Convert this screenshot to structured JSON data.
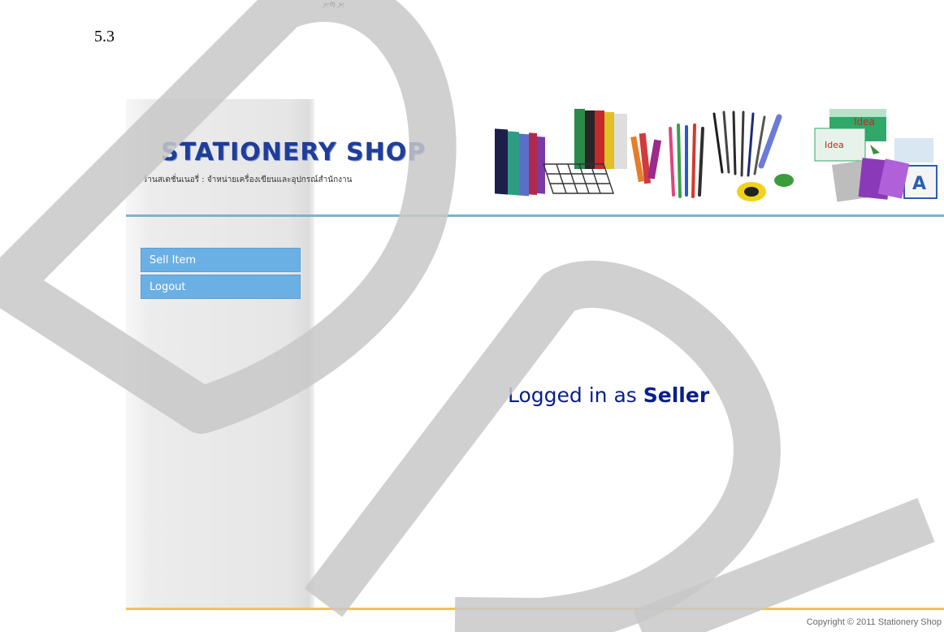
{
  "document": {
    "section_number": "5.3",
    "top_fragment": "ผู้ใช้"
  },
  "header": {
    "logo_title": "STATIONERY SHOP",
    "logo_subtitle": "ร้านสเตชั่นเนอรี่ : จำหน่ายเครื่องเขียนและอุปกรณ์สำนักงาน",
    "banner_brand_text": "Idea"
  },
  "sidebar": {
    "items": [
      {
        "label": "Sell Item"
      },
      {
        "label": "Logout"
      }
    ]
  },
  "main": {
    "status_prefix": "Logged in as",
    "status_role": "Seller"
  },
  "footer": {
    "copyright": "Copyright © 2011 Stationery Shop"
  },
  "colors": {
    "nav_button": "#6ab0e4",
    "header_rule": "#7fb2cf",
    "footer_rule": "#f2c25a",
    "title_blue": "#1f3d9a",
    "status_text": "#0a1f8a",
    "watermark": "#c8c8c8"
  },
  "icons": [
    "binders-image",
    "wire-tray-image",
    "highlighters-image",
    "pens-image",
    "correction-tape-image",
    "paper-ream-image",
    "notebooks-image",
    "draft-watermark"
  ]
}
